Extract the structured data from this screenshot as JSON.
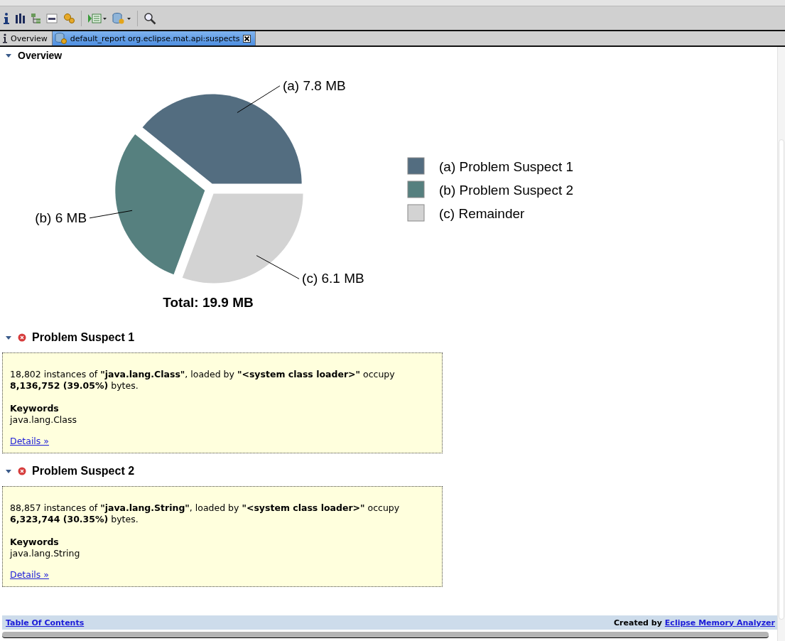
{
  "tabs": [
    {
      "label": "Overview",
      "selected": false,
      "kind": "info"
    },
    {
      "label": "default_report  org.eclipse.mat.api:suspects",
      "selected": true,
      "kind": "report"
    }
  ],
  "overview": {
    "title": "Overview",
    "expanded": true,
    "chart_data": {
      "type": "pie",
      "title": "Total: 19.9 MB",
      "categories": [
        "(a)  Problem Suspect 1",
        "(b)  Problem Suspect 2",
        "(c)  Remainder"
      ],
      "values": [
        7.8,
        6,
        6.1
      ],
      "colors": [
        "#536d80",
        "#56807f",
        "#d3d3d3"
      ],
      "value_labels": [
        "(a)  7.8 MB",
        "(b)  6 MB",
        "(c)  6.1 MB"
      ],
      "legend": "right"
    }
  },
  "suspects": [
    {
      "title": "Problem Suspect 1",
      "expanded": true,
      "description": "18,802 instances of **\"java.lang.Class\"**, loaded by **\"<system class loader>\"** occupy **8,136,752 (39.05%)** bytes.",
      "keywords_label": "Keywords",
      "keywords": "java.lang.Class",
      "link": "Details »"
    },
    {
      "title": "Problem Suspect 2",
      "expanded": true,
      "description": "88,857 instances of **\"java.lang.String\"**, loaded by **\"<system class loader>\"** occupy **6,323,744 (30.35%)** bytes.",
      "keywords_label": "Keywords",
      "keywords": "java.lang.String",
      "link": "Details »"
    }
  ],
  "footer": {
    "toc_link": "Table Of Contents",
    "credit": "Created by",
    "credit_link": "Eclipse Memory Analyzer"
  }
}
